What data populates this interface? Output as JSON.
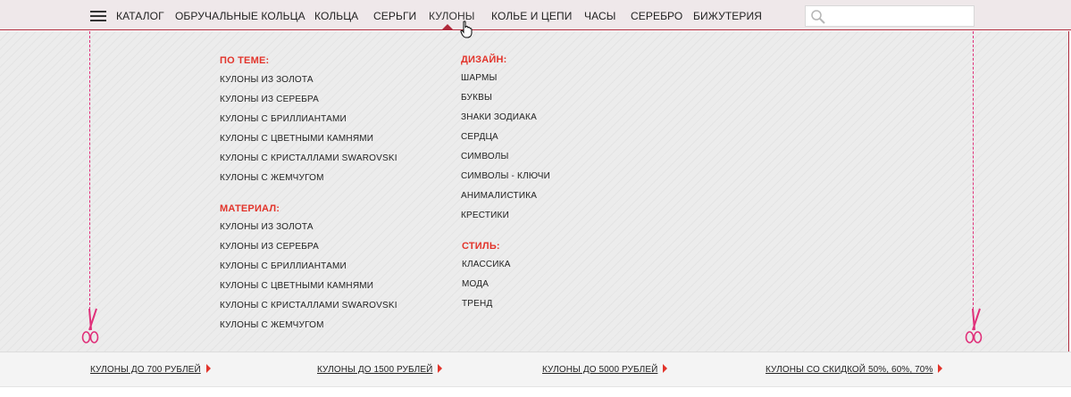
{
  "nav": {
    "catalog": "КАТАЛОГ",
    "items": [
      "ОБРУЧАЛЬНЫЕ КОЛЬЦА",
      "КОЛЬЦА",
      "СЕРЬГИ",
      "КУЛОНЫ",
      "КОЛЬЕ И ЦЕПИ",
      "ЧАСЫ",
      "СЕРЕБРО",
      "БИЖУТЕРИЯ"
    ],
    "active": "КУЛОНЫ",
    "search": {
      "value": "",
      "placeholder": ""
    }
  },
  "menu": {
    "by_theme": {
      "title": "ПО ТЕМЕ:",
      "items": [
        "КУЛОНЫ ИЗ ЗОЛОТА",
        "КУЛОНЫ ИЗ СЕРЕБРА",
        "КУЛОНЫ С БРИЛЛИАНТАМИ",
        "КУЛОНЫ С ЦВЕТНЫМИ КАМНЯМИ",
        "КУЛОНЫ С КРИСТАЛЛАМИ SWAROVSKI",
        "КУЛОНЫ С ЖЕМЧУГОМ"
      ]
    },
    "material": {
      "title": "МАТЕРИАЛ:",
      "items": [
        "КУЛОНЫ ИЗ ЗОЛОТА",
        "КУЛОНЫ ИЗ СЕРЕБРА",
        "КУЛОНЫ С БРИЛЛИАНТАМИ",
        "КУЛОНЫ С ЦВЕТНЫМИ КАМНЯМИ",
        "КУЛОНЫ С КРИСТАЛЛАМИ SWAROVSKI",
        "КУЛОНЫ С ЖЕМЧУГОМ"
      ]
    },
    "design": {
      "title": "ДИЗАЙН:",
      "items": [
        "ШАРМЫ",
        "БУКВЫ",
        "ЗНАКИ ЗОДИАКА",
        "СЕРДЦА",
        "СИМВОЛЫ",
        "СИМВОЛЫ - КЛЮЧИ",
        "АНИМАЛИСТИКА",
        "КРЕСТИКИ"
      ]
    },
    "style": {
      "title": "СТИЛЬ:",
      "items": [
        "КЛАССИКА",
        "МОДА",
        "ТРЕНД"
      ]
    }
  },
  "bottom": {
    "links": [
      "КУЛОНЫ ДО 700 РУБЛЕЙ",
      "КУЛОНЫ ДО 1500 РУБЛЕЙ",
      "КУЛОНЫ ДО 5000 РУБЛЕЙ",
      "КУЛОНЫ СО СКИДКОЙ 50%, 60%, 70%"
    ]
  },
  "icons": {
    "menu": "hamburger-icon",
    "search": "search-icon",
    "cursor": "hand-pointer-icon",
    "scissors": "scissors-icon",
    "arrow": "red-arrow-icon"
  },
  "colors": {
    "accent_red": "#e2342b",
    "border_red": "#b0283a",
    "cut_line_pink": "#e0307a",
    "nav_bg": "#efe8ea"
  }
}
